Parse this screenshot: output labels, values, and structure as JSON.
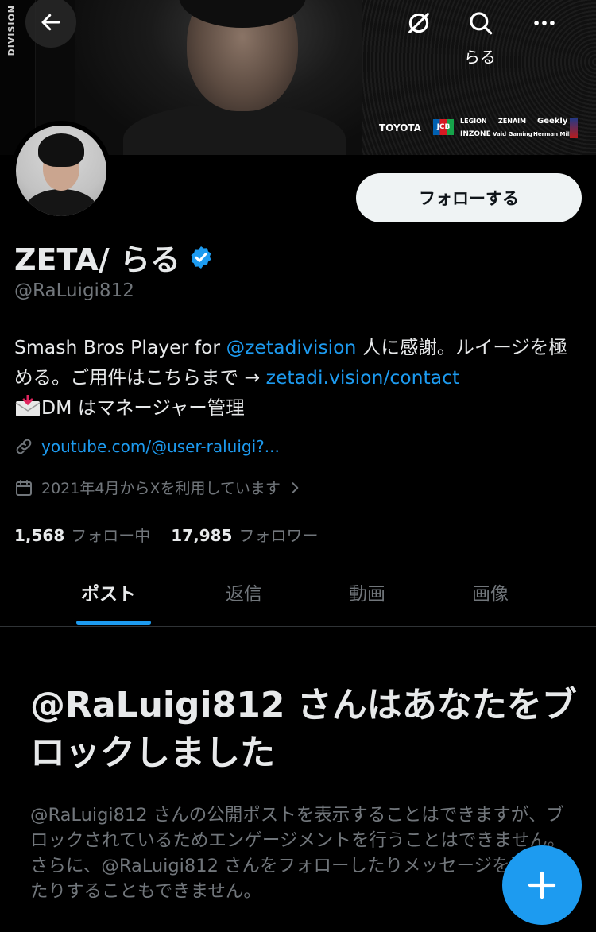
{
  "banner": {
    "brand_text": "DIVISION",
    "sponsors": {
      "toyota": "TOYOTA",
      "jcb": "JCB",
      "lenovo": "LEGION",
      "zenaim": "ZENAIM",
      "geekly": "Geekly",
      "inzone": "INZONE",
      "vaid": "Vaid Gaming",
      "hm": "Herman Miller"
    }
  },
  "topbar": {
    "search_caption": "らる"
  },
  "profile": {
    "follow_label": "フォローする",
    "display_name": "ZETA/ らる",
    "handle": "@RaLuigi812",
    "bio": {
      "part1": "Smash Bros Player for ",
      "mention": "@zetadivision",
      "part2": " 人に感謝。ルイージを極める。ご用件はこちらまで → ",
      "link": "zetadi.vision/contact",
      "part3": "DM はマネージャー管理"
    },
    "url": "youtube.com/@user-raluigi?...",
    "joined": "2021年4月からXを利用しています",
    "following_count": "1,568",
    "following_label": "フォロー中",
    "followers_count": "17,985",
    "followers_label": "フォロワー"
  },
  "tabs": [
    "ポスト",
    "返信",
    "動画",
    "画像"
  ],
  "blocked": {
    "title": "@RaLuigi812 さんはあなたをブロックしました",
    "body": "@RaLuigi812 さんの公開ポストを表示することはできますが、ブロックされているためエンゲージメントを行うことはできません。さらに、@RaLuigi812 さんをフォローしたりメッセージを送信したりすることもできません。"
  },
  "colors": {
    "background": "#000000",
    "accent": "#1d9bf0",
    "text": "#e7e9ea",
    "muted": "#71767b"
  }
}
